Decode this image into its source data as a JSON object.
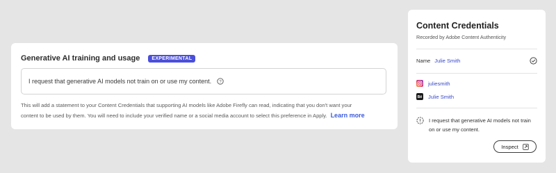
{
  "left_panel": {
    "title": "Generative AI training and usage",
    "badge": "EXPERIMENTAL",
    "statement": "I request that generative AI models not train on or use my content.",
    "help_text_line1": "This will add a statement to your Content Credentials that supporting AI models like Adobe Firefly can read, indicating that you don't want your",
    "help_text_line2": "content to be used by them. You will need to include your verified name or a social media account to select this preference in Apply.",
    "learn_more": "Learn more"
  },
  "right_panel": {
    "title": "Content Credentials",
    "subtitle": "Recorded by Adobe Content Authenticity",
    "name_label": "Name",
    "name_value": "Julie Smith",
    "socials": [
      {
        "icon": "instagram-icon",
        "handle": "juliesmith"
      },
      {
        "icon": "behance-icon",
        "handle": "Julie Smith"
      }
    ],
    "preference_text_line1": "I request that generative AI models not train",
    "preference_text_line2": "on or use my content.",
    "inspect_label": "Inspect"
  },
  "colors": {
    "background": "#e5e5e5",
    "accent_badge": "#4b4fd9",
    "link": "#3b5bdb"
  }
}
